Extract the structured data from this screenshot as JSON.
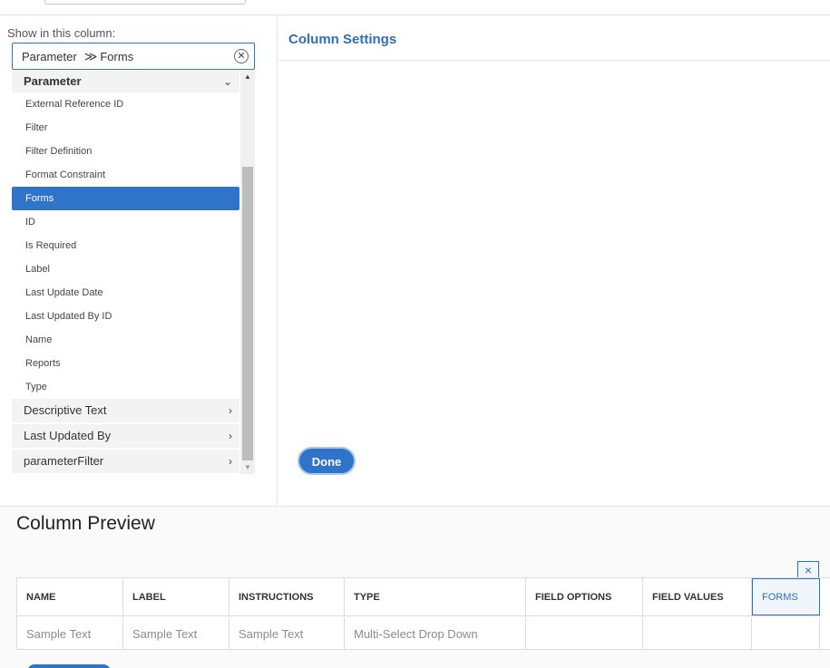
{
  "left_panel": {
    "show_label": "Show in this column:",
    "selector": {
      "part1": "Parameter",
      "separator": "≫",
      "part2": "Forms"
    },
    "open_group": {
      "label": "Parameter",
      "items": [
        "External Reference ID",
        "Filter",
        "Filter Definition",
        "Format Constraint",
        "Forms",
        "ID",
        "Is Required",
        "Label",
        "Last Update Date",
        "Last Updated By ID",
        "Name",
        "Reports",
        "Type"
      ],
      "selected_item": "Forms"
    },
    "collapsed_groups": [
      "Descriptive Text",
      "Last Updated By",
      "parameterFilter"
    ]
  },
  "settings": {
    "title": "Column Settings",
    "done_label": "Done"
  },
  "preview": {
    "title": "Column Preview",
    "close_label": "×",
    "columns": [
      "NAME",
      "LABEL",
      "INSTRUCTIONS",
      "TYPE",
      "FIELD OPTIONS",
      "FIELD VALUES",
      "FORMS"
    ],
    "row": [
      "Sample Text",
      "Sample Text",
      "Sample Text",
      "Multi-Select Drop Down",
      "",
      "",
      ""
    ],
    "active_column": "FORMS"
  },
  "icons": {
    "clear": "close-circle-icon",
    "chevron_down": "chevron-down-icon",
    "chevron_right": "chevron-right-icon",
    "scroll_up": "scroll-up-arrow-icon",
    "scroll_down": "scroll-down-arrow-icon",
    "close": "close-icon"
  },
  "colors": {
    "accent": "#2f74c9",
    "title_blue": "#2f6fbb"
  }
}
